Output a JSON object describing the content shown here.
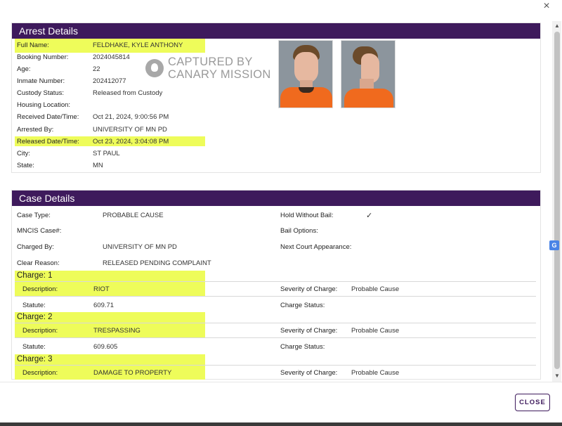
{
  "modal": {
    "close_icon": "×"
  },
  "arrest": {
    "title": "Arrest Details",
    "rows": [
      {
        "label": "Full Name:",
        "value": "FELDHAKE, KYLE ANTHONY"
      },
      {
        "label": "Booking Number:",
        "value": "2024045814"
      },
      {
        "label": "Age:",
        "value": "22"
      },
      {
        "label": "Inmate Number:",
        "value": "202412077"
      },
      {
        "label": "Custody Status:",
        "value": "Released from Custody"
      },
      {
        "label": "Housing Location:",
        "value": ""
      },
      {
        "label": "Received Date/Time:",
        "value": "Oct 21, 2024, 9:00:56 PM"
      },
      {
        "label": "Arrested By:",
        "value": "UNIVERSITY OF MN PD"
      },
      {
        "label": "Released Date/Time:",
        "value": "Oct 23, 2024, 3:04:08 PM"
      },
      {
        "label": "City:",
        "value": "ST PAUL"
      },
      {
        "label": "State:",
        "value": "MN"
      }
    ],
    "watermark": {
      "line1": "CAPTURED BY",
      "line2": "CANARY MISSION"
    }
  },
  "case": {
    "title": "Case Details",
    "left": [
      {
        "label": "Case Type:",
        "value": "PROBABLE CAUSE"
      },
      {
        "label": "MNCIS Case#:",
        "value": ""
      },
      {
        "label": "Charged By:",
        "value": "UNIVERSITY OF MN PD"
      },
      {
        "label": "Clear Reason:",
        "value": "RELEASED PENDING COMPLAINT"
      }
    ],
    "right": [
      {
        "label": "Hold Without Bail:",
        "value": "✓"
      },
      {
        "label": "Bail Options:",
        "value": ""
      },
      {
        "label": "Next Court Appearance:",
        "value": ""
      }
    ],
    "charges": [
      {
        "title": "Charge: 1",
        "desc_label": "Description:",
        "desc": "RIOT",
        "statute_label": "Statute:",
        "statute": "609.71",
        "severity_label": "Severity of Charge:",
        "severity": "Probable Cause",
        "status_label": "Charge Status:"
      },
      {
        "title": "Charge: 2",
        "desc_label": "Description:",
        "desc": "TRESPASSING",
        "statute_label": "Statute:",
        "statute": "609.605",
        "severity_label": "Severity of Charge:",
        "severity": "Probable Cause",
        "status_label": "Charge Status:"
      },
      {
        "title": "Charge: 3",
        "desc_label": "Description:",
        "desc": "DAMAGE TO PROPERTY",
        "severity_label": "Severity of Charge:",
        "severity": "Probable Cause"
      }
    ]
  },
  "footer": {
    "close_label": "CLOSE"
  },
  "colors": {
    "header": "#3e1a5c",
    "highlight": "#eefc5a"
  }
}
